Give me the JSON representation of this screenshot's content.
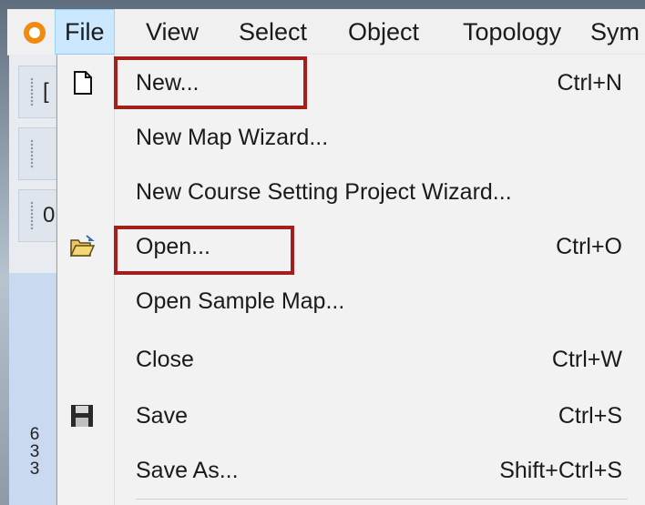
{
  "menubar": {
    "items": [
      {
        "label": "File"
      },
      {
        "label": "View"
      },
      {
        "label": "Select"
      },
      {
        "label": "Object"
      },
      {
        "label": "Topology"
      },
      {
        "label": "Sym"
      }
    ]
  },
  "toolbar": {
    "fragments": [
      "[",
      "",
      "0"
    ]
  },
  "ruler": {
    "value": "6\n3\n3"
  },
  "file_menu": {
    "items": [
      {
        "label": "New...",
        "shortcut": "Ctrl+N",
        "icon": "new-document-icon"
      },
      {
        "label": "New Map Wizard...",
        "shortcut": ""
      },
      {
        "label": "New Course Setting Project Wizard...",
        "shortcut": ""
      },
      {
        "label": "Open...",
        "shortcut": "Ctrl+O",
        "icon": "open-folder-icon"
      },
      {
        "label": "Open Sample Map...",
        "shortcut": ""
      },
      {
        "label": "Close",
        "shortcut": "Ctrl+W"
      },
      {
        "label": "Save",
        "shortcut": "Ctrl+S",
        "icon": "save-disk-icon"
      },
      {
        "label": "Save As...",
        "shortcut": "Shift+Ctrl+S"
      }
    ]
  },
  "colors": {
    "highlight_box": "#a31f1c",
    "menu_open_bg": "#cce8ff",
    "logo_orange": "#f08a10"
  }
}
